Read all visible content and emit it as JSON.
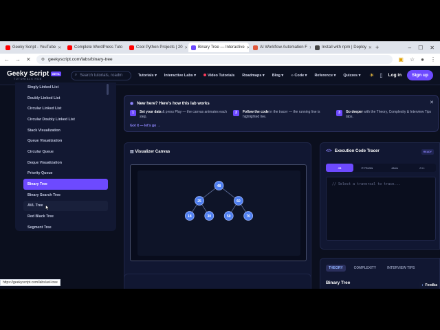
{
  "browser": {
    "tabs": [
      {
        "label": "Geeky Script - YouTube",
        "color": "#ff0000",
        "active": false
      },
      {
        "label": "Complete WordPress Tuto",
        "color": "#ff0000",
        "active": false
      },
      {
        "label": "Cool Python Projects | 20",
        "color": "#ff0000",
        "active": false
      },
      {
        "label": "Binary Tree — Interactive",
        "color": "#6d4aff",
        "active": true
      },
      {
        "label": "AI Workflow Automation F",
        "color": "#e0583c",
        "active": false
      },
      {
        "label": "Install with npm | Deploy",
        "color": "#444",
        "active": false
      }
    ],
    "url": "geekyscript.com/labs/binary-tree",
    "status_url": "https://geekyscript.com/labs/avl-tree"
  },
  "site": {
    "brand": "Geeky Script",
    "beta": "BETA",
    "tagline": "TUTORIALS HUB",
    "search_placeholder": "Search tutorials, roadm",
    "menu": [
      "Tutorials ▾",
      "Interactive Labs ▾",
      "Video Tutorials",
      "Roadmaps ▾",
      "Blog ▾",
      "‹› Code ▾",
      "Reference ▾",
      "Quizzes ▾"
    ],
    "login": "Log in",
    "signup": "Sign up"
  },
  "sidebar": {
    "items": [
      "Singly Linked List",
      "Doubly Linked List",
      "Circular Linked List",
      "Circular Doubly Linked List",
      "Stack Visualization",
      "Queue Visualization",
      "Circular Queue",
      "Deque Visualization",
      "Priority Queue",
      "Binary Tree",
      "Binary Search Tree",
      "AVL Tree",
      "Red Black Tree",
      "Segment Tree"
    ],
    "active_index": 9,
    "hover_index": 11
  },
  "banner": {
    "title": "New here? Here's how this lab works",
    "steps": [
      {
        "n": "1",
        "bold": "Set your data",
        "rest": " & press Play — the canvas animates each step."
      },
      {
        "n": "2",
        "bold": "Follow the code",
        "rest": " in the tracer — the running line is highlighted live."
      },
      {
        "n": "3",
        "bold": "Go deeper",
        "rest": " with the Theory, Complexity & Interview Tips tabs."
      }
    ],
    "cta": "Got it — let's go →"
  },
  "canvas": {
    "title": "Visualizer Canvas",
    "tree": {
      "root": 48,
      "level1": [
        25,
        60
      ],
      "level2": [
        18,
        30,
        50,
        70
      ]
    }
  },
  "tracer": {
    "title": "Execution Code Tracer",
    "code_icon": "</>",
    "badge": "READY",
    "langs": [
      "JS",
      "PYTHON",
      "JAVA",
      "C++"
    ],
    "active_lang": 0,
    "placeholder": "// Select a traversal to trace..."
  },
  "theory": {
    "tabs": [
      "THEORY",
      "COMPLEXITY",
      "INTERVIEW TIPS"
    ],
    "active_tab": 0,
    "title": "Binary Tree",
    "feedback": "Feedba"
  }
}
